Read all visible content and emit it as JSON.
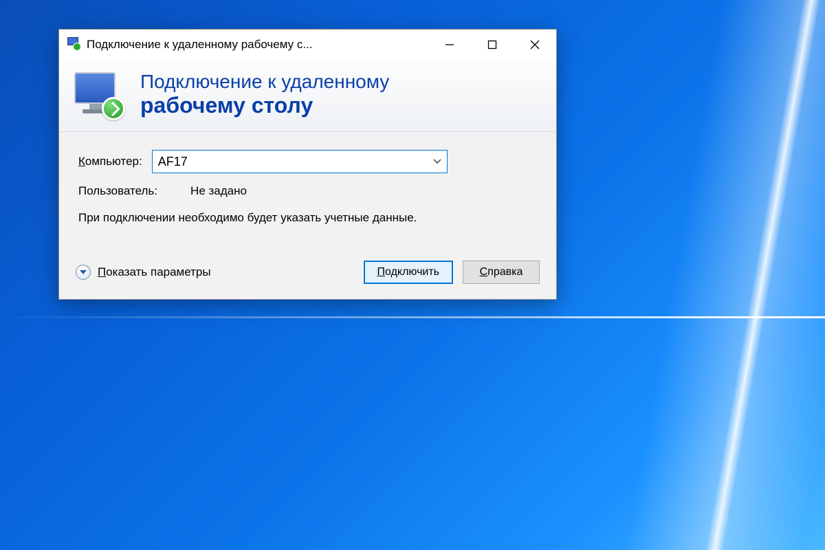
{
  "window": {
    "title": "Подключение к удаленному рабочему с..."
  },
  "banner": {
    "line1": "Подключение к удаленному",
    "line2": "рабочему столу"
  },
  "form": {
    "computer_label": "Компьютер:",
    "computer_value": "AF17",
    "user_label": "Пользователь:",
    "user_value": "Не задано",
    "info_text": "При подключении необходимо будет указать учетные данные."
  },
  "footer": {
    "show_options": "Показать параметры",
    "connect": "Подключить",
    "help": "Справка"
  }
}
